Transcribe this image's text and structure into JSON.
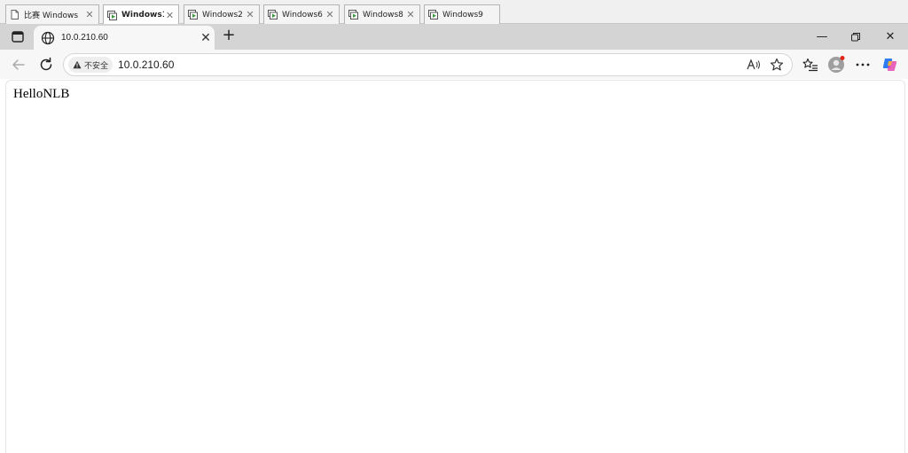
{
  "vm_tabs": [
    {
      "label": "比赛 Windows",
      "icon": "document-icon",
      "active": false
    },
    {
      "label": "Windows1",
      "icon": "vm-icon",
      "active": true
    },
    {
      "label": "Windows2",
      "icon": "vm-icon",
      "active": false
    },
    {
      "label": "Windows6",
      "icon": "vm-icon",
      "active": false
    },
    {
      "label": "Windows8",
      "icon": "vm-icon",
      "active": false
    },
    {
      "label": "Windows9",
      "icon": "vm-icon",
      "active": false
    }
  ],
  "browser": {
    "tab_title": "10.0.210.60",
    "security_label": "不安全",
    "url": "10.0.210.60"
  },
  "page": {
    "body_text": "HelloNLB"
  },
  "colors": {
    "vm_strip_bg": "#f0f0f0",
    "title_bar_bg": "#d4d4d4",
    "toolbar_bg": "#f7f7f7",
    "vm_icon_green": "#3a9a3a",
    "profile_dot": "#e0261b"
  }
}
